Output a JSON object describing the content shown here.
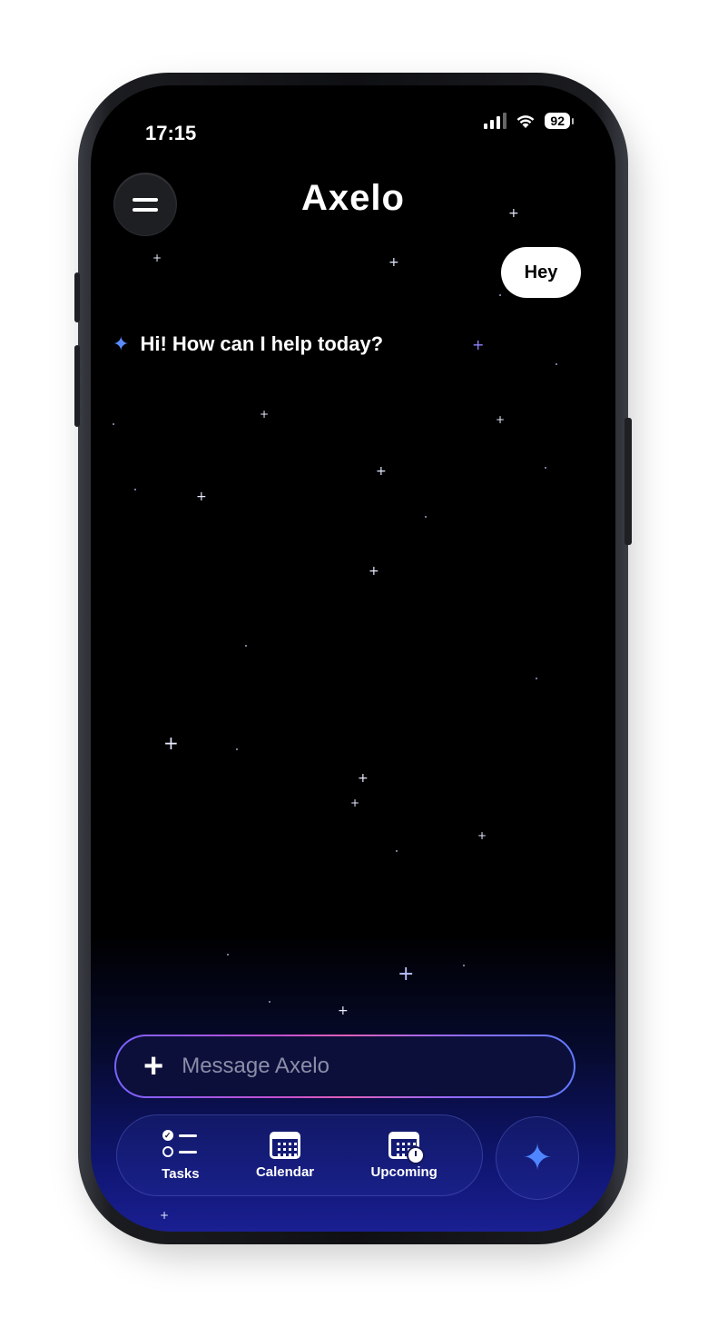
{
  "status_bar": {
    "time": "17:15",
    "battery": "92"
  },
  "header": {
    "title": "Axelo"
  },
  "chat": {
    "user_message": "Hey",
    "bot_message": "Hi! How can I help today?"
  },
  "composer": {
    "placeholder": "Message Axelo"
  },
  "tabs": [
    {
      "label": "Tasks",
      "icon": "tasks-icon"
    },
    {
      "label": "Calendar",
      "icon": "calendar-icon"
    },
    {
      "label": "Upcoming",
      "icon": "upcoming-icon"
    }
  ],
  "colors": {
    "accent": "#4f86ff",
    "background": "#000000",
    "glow": "#1a1f92"
  }
}
